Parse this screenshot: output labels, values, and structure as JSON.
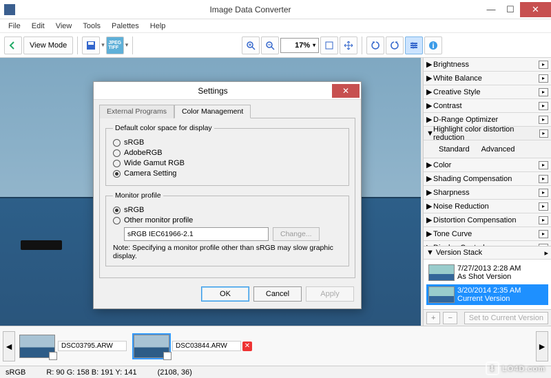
{
  "app": {
    "title": "Image Data Converter"
  },
  "menu": {
    "file": "File",
    "edit": "Edit",
    "view": "View",
    "tools": "Tools",
    "palettes": "Palettes",
    "help": "Help"
  },
  "toolbar": {
    "view_mode": "View Mode",
    "zoom": "17%"
  },
  "side": {
    "items": [
      {
        "label": "Brightness"
      },
      {
        "label": "White Balance"
      },
      {
        "label": "Creative Style"
      },
      {
        "label": "Contrast"
      },
      {
        "label": "D-Range Optimizer"
      },
      {
        "label": "Highlight color distortion reduction"
      },
      {
        "label": "Color"
      },
      {
        "label": "Shading Compensation"
      },
      {
        "label": "Sharpness"
      },
      {
        "label": "Noise Reduction"
      },
      {
        "label": "Distortion Compensation"
      },
      {
        "label": "Tone Curve"
      },
      {
        "label": "Display Control"
      }
    ],
    "expanded_index": 5,
    "hl": {
      "standard": "Standard",
      "advanced": "Advanced"
    }
  },
  "vstack": {
    "title": "Version Stack",
    "items": [
      {
        "time": "7/27/2013 2:28 AM",
        "name": "As Shot Version"
      },
      {
        "time": "3/20/2014 2:35 AM",
        "name": "Current Version"
      }
    ],
    "save_btn": "Set to Current Version",
    "add": "+",
    "del": "−"
  },
  "film": {
    "items": [
      {
        "name": "DSC03795.ARW"
      },
      {
        "name": "DSC03844.ARW"
      }
    ]
  },
  "status": {
    "space": "sRGB",
    "rgb": "R: 90  G: 158  B: 191  Y: 141",
    "pos": "(2108,   36)"
  },
  "dialog": {
    "title": "Settings",
    "tabs": {
      "ext": "External Programs",
      "color": "Color Management"
    },
    "group1": "Default color space for display",
    "opts1": {
      "srgb": "sRGB",
      "adobe": "AdobeRGB",
      "wide": "Wide Gamut RGB",
      "camera": "Camera Setting"
    },
    "group2": "Monitor profile",
    "opts2": {
      "srgb": "sRGB",
      "other": "Other monitor profile"
    },
    "mp_value": "sRGB IEC61966-2.1",
    "change": "Change...",
    "note": "Note: Specifying a monitor profile other than sRGB may slow graphic display.",
    "ok": "OK",
    "cancel": "Cancel",
    "apply": "Apply"
  },
  "watermark": "LO4D.com"
}
